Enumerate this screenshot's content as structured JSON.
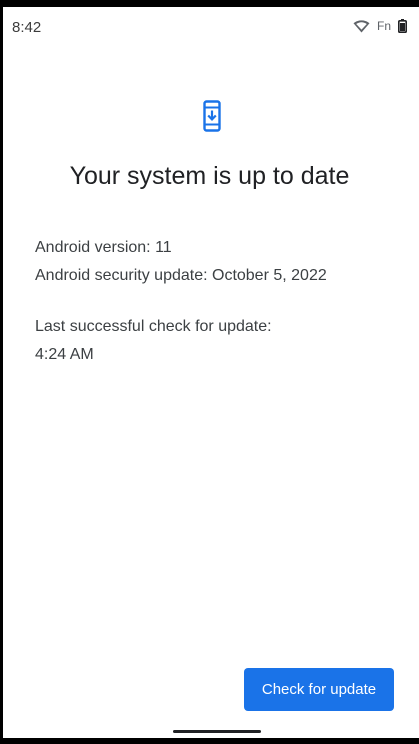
{
  "status_bar": {
    "time": "8:42",
    "carrier": "Fn",
    "icons": [
      "wifi-icon",
      "battery-icon"
    ]
  },
  "main": {
    "icon": "system-update-icon",
    "accent_color": "#1a73e8",
    "title": "Your system is up to date",
    "android_version": "Android version: 11",
    "security_update": "Android security update: October 5, 2022",
    "last_check_label": "Last successful check for update:",
    "last_check_time": "4:24 AM"
  },
  "actions": {
    "check_button_label": "Check for update"
  }
}
